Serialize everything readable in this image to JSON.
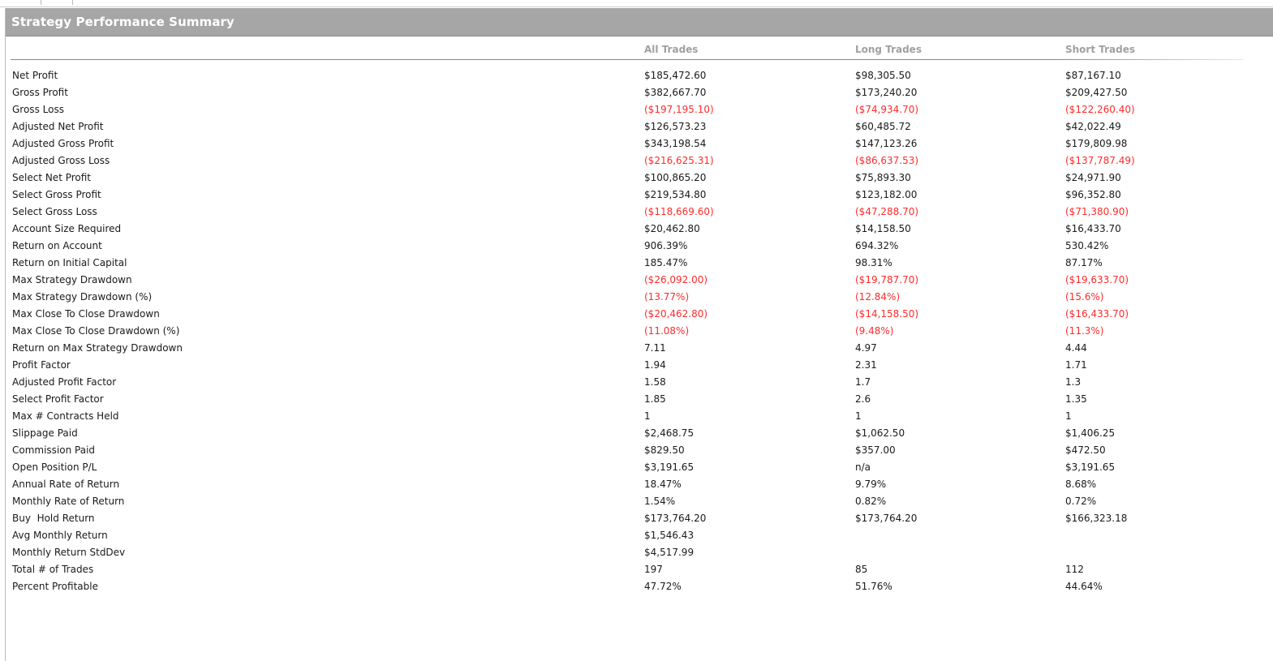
{
  "title": "Strategy Performance Summary",
  "columns": [
    "All Trades",
    "Long Trades",
    "Short Trades"
  ],
  "rows": [
    {
      "label": "Net Profit",
      "all": "$185,472.60",
      "long": "$98,305.50",
      "short": "$87,167.10"
    },
    {
      "label": "Gross Profit",
      "all": "$382,667.70",
      "long": "$173,240.20",
      "short": "$209,427.50"
    },
    {
      "label": "Gross Loss",
      "all": "($197,195.10)",
      "long": "($74,934.70)",
      "short": "($122,260.40)"
    },
    {
      "label": "Adjusted Net Profit",
      "all": "$126,573.23",
      "long": "$60,485.72",
      "short": "$42,022.49"
    },
    {
      "label": "Adjusted Gross Profit",
      "all": "$343,198.54",
      "long": "$147,123.26",
      "short": "$179,809.98"
    },
    {
      "label": "Adjusted Gross Loss",
      "all": "($216,625.31)",
      "long": "($86,637.53)",
      "short": "($137,787.49)"
    },
    {
      "label": "Select Net Profit",
      "all": "$100,865.20",
      "long": "$75,893.30",
      "short": "$24,971.90"
    },
    {
      "label": "Select Gross Profit",
      "all": "$219,534.80",
      "long": "$123,182.00",
      "short": "$96,352.80"
    },
    {
      "label": "Select Gross Loss",
      "all": "($118,669.60)",
      "long": "($47,288.70)",
      "short": "($71,380.90)"
    },
    {
      "label": "Account Size Required",
      "all": "$20,462.80",
      "long": "$14,158.50",
      "short": "$16,433.70"
    },
    {
      "label": "Return on Account",
      "all": "906.39%",
      "long": "694.32%",
      "short": "530.42%"
    },
    {
      "label": "Return on Initial Capital",
      "all": "185.47%",
      "long": "98.31%",
      "short": "87.17%"
    },
    {
      "label": "Max Strategy Drawdown",
      "all": "($26,092.00)",
      "long": "($19,787.70)",
      "short": "($19,633.70)"
    },
    {
      "label": "Max Strategy Drawdown (%)",
      "all": "(13.77%)",
      "long": "(12.84%)",
      "short": "(15.6%)"
    },
    {
      "label": "Max Close To Close Drawdown",
      "all": "($20,462.80)",
      "long": "($14,158.50)",
      "short": "($16,433.70)"
    },
    {
      "label": "Max Close To Close Drawdown (%)",
      "all": "(11.08%)",
      "long": "(9.48%)",
      "short": "(11.3%)"
    },
    {
      "label": "Return on Max Strategy Drawdown",
      "all": "7.11",
      "long": "4.97",
      "short": "4.44"
    },
    {
      "label": "Profit Factor",
      "all": "1.94",
      "long": "2.31",
      "short": "1.71"
    },
    {
      "label": "Adjusted Profit Factor",
      "all": "1.58",
      "long": "1.7",
      "short": "1.3"
    },
    {
      "label": "Select Profit Factor",
      "all": "1.85",
      "long": "2.6",
      "short": "1.35"
    },
    {
      "label": "Max # Contracts Held",
      "all": "1",
      "long": "1",
      "short": "1"
    },
    {
      "label": "Slippage Paid",
      "all": "$2,468.75",
      "long": "$1,062.50",
      "short": "$1,406.25"
    },
    {
      "label": "Commission Paid",
      "all": "$829.50",
      "long": "$357.00",
      "short": "$472.50"
    },
    {
      "label": "Open Position P/L",
      "all": "$3,191.65",
      "long": "n/a",
      "short": "$3,191.65"
    },
    {
      "label": "Annual Rate of Return",
      "all": "18.47%",
      "long": "9.79%",
      "short": "8.68%"
    },
    {
      "label": "Monthly Rate of Return",
      "all": "1.54%",
      "long": "0.82%",
      "short": "0.72%"
    },
    {
      "label": "Buy  Hold Return",
      "all": "$173,764.20",
      "long": "$173,764.20",
      "short": "$166,323.18"
    },
    {
      "label": "Avg Monthly Return",
      "all": "$1,546.43",
      "long": "",
      "short": ""
    },
    {
      "label": "Monthly Return StdDev",
      "all": "$4,517.99",
      "long": "",
      "short": ""
    },
    {
      "label": "Total # of Trades",
      "all": "197",
      "long": "85",
      "short": "112"
    },
    {
      "label": "Percent Profitable",
      "all": "47.72%",
      "long": "51.76%",
      "short": "44.64%"
    }
  ]
}
